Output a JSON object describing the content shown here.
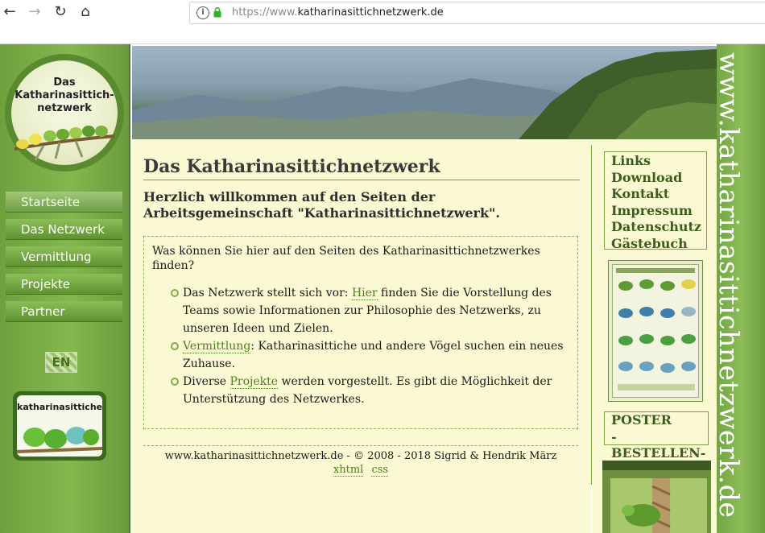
{
  "browser": {
    "url_scheme": "https://www.",
    "url_host": "katharinasittichnetzwerk.de",
    "back_icon": "arrow-left-icon",
    "forward_icon": "arrow-right-icon",
    "reload_icon": "reload-icon",
    "home_icon": "home-icon"
  },
  "logo": {
    "line1": "Das",
    "line2": "Katharinasittich-",
    "line3": "netzwerk"
  },
  "nav": {
    "items": [
      {
        "label": "Startseite",
        "active": true
      },
      {
        "label": "Das Netzwerk"
      },
      {
        "label": "Vermittlung"
      },
      {
        "label": "Projekte"
      },
      {
        "label": "Partner"
      }
    ],
    "language_flag": "EN"
  },
  "badge": {
    "text": "katharinasittiche.de"
  },
  "main": {
    "title": "Das Katharinasittichnetzwerk",
    "welcome": "Herzlich willkommen auf den Seiten der Arbeitsgemeinschaft \"Katharinasittichnetzwerk\".",
    "question": "Was können Sie hier auf den Seiten des Katharinasittichnetzwerkes finden?",
    "items": [
      {
        "before": "Das Netzwerk stellt sich vor: ",
        "link": "Hier",
        "after": " finden Sie die Vorstellung des Teams sowie Informationen zur Philosophie des Netzwerks, zu unseren Ideen und Zielen."
      },
      {
        "before": "",
        "link": "Vermittlung",
        "after": ": Katharinasittiche und andere Vögel suchen ein neues Zuhause."
      },
      {
        "before": "Diverse ",
        "link": "Projekte",
        "after": " werden vorgestellt. Es gibt die Möglichkeit der Unterstützung des Netzwerkes."
      }
    ],
    "footer_copy": "www.katharinasittichnetzwerk.de - © 2008 - 2018 Sigrid & Hendrik März",
    "footer_link_xhtml": "xhtml",
    "footer_link_css": "css"
  },
  "sidebar": {
    "links": [
      "Links",
      "Download",
      "Kontakt",
      "Impressum",
      "Datenschutz",
      "Gästebuch"
    ],
    "poster_line1": "POSTER",
    "poster_line2": "-BESTELLEN-"
  },
  "vertical_banner": {
    "text": "www.katharinasittichnetzwerk.de"
  },
  "colors": {
    "accent_green": "#7aa240",
    "content_bg": "#fbf9d3",
    "link_green": "#4f7d1f"
  }
}
